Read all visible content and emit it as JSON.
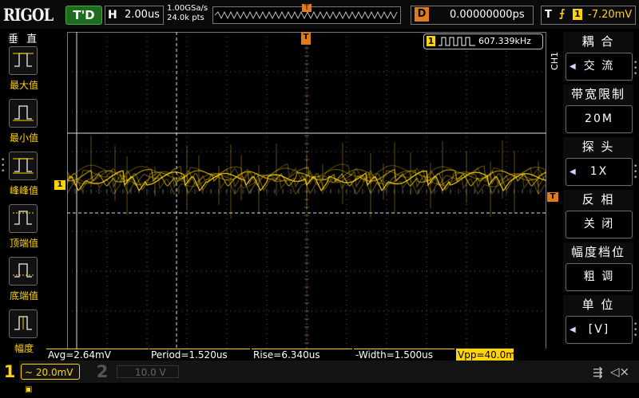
{
  "topbar": {
    "logo": "RIGOL",
    "run_status": "T'D",
    "timebase_label": "H",
    "timebase_value": "2.00us",
    "sample_rate": "1.00GSa/s",
    "memory_depth": "24.0k pts",
    "delay_label": "D",
    "delay_value": "0.00000000ps",
    "trigger_label": "T",
    "trigger_source": "1",
    "trigger_level": "-7.20mV"
  },
  "left_panel": {
    "title": "垂 直",
    "items": [
      {
        "label": "最大值",
        "icon": "max-measure-icon"
      },
      {
        "label": "最小值",
        "icon": "min-measure-icon"
      },
      {
        "label": "峰峰值",
        "icon": "peak-peak-measure-icon"
      },
      {
        "label": "顶端值",
        "icon": "top-measure-icon"
      },
      {
        "label": "底端值",
        "icon": "base-measure-icon"
      },
      {
        "label": "幅度",
        "icon": "amplitude-measure-icon"
      }
    ]
  },
  "screen": {
    "channel_marker": "1",
    "trigger_pos_marker": "T",
    "trigger_level_marker": "T",
    "freq_channel": "1",
    "frequency": "607.339kHz"
  },
  "right_panel": {
    "channel": "CH1",
    "items": [
      {
        "title": "耦 合",
        "value": "交 流"
      },
      {
        "title": "带宽限制",
        "value": "20M"
      },
      {
        "title": "探 头",
        "value": "1X"
      },
      {
        "title": "反 相",
        "value": "关 闭"
      },
      {
        "title": "幅度档位",
        "value": "粗 调"
      },
      {
        "title": "单 位",
        "value": "[V]"
      }
    ]
  },
  "measurements": [
    {
      "text": "Avg=2.64mV",
      "highlight": false
    },
    {
      "text": "Period=1.520us",
      "highlight": false
    },
    {
      "text": "Rise=6.340us",
      "highlight": false
    },
    {
      "text": "-Width=1.500us",
      "highlight": false
    },
    {
      "text": "Vpp=40.0mV",
      "highlight": true
    }
  ],
  "bottom": {
    "ch1_num": "1",
    "ch1_scale": "~ 20.0mV",
    "ch2_num": "2",
    "ch2_scale": "10.0 V"
  },
  "colors": {
    "channel1": "#ffd400",
    "trigger": "#e07a1a",
    "grid": "#777777",
    "background": "#000000"
  }
}
